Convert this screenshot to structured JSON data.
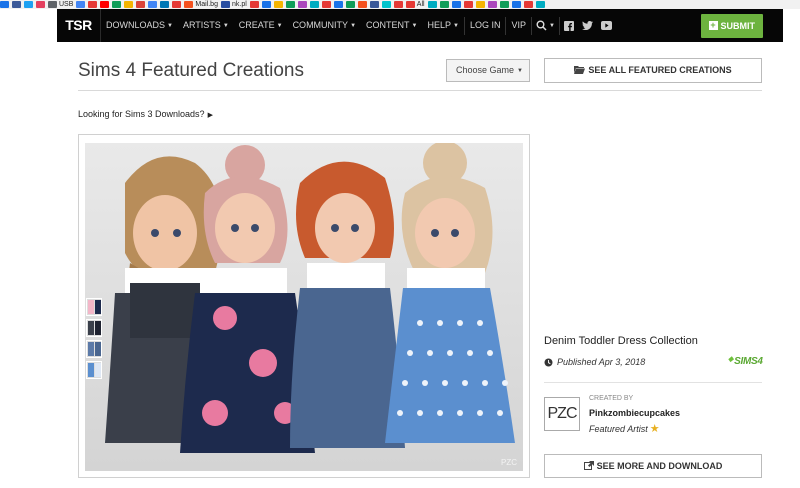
{
  "bookmarks": [
    {
      "label": "",
      "color": "#1a73e8"
    },
    {
      "label": "",
      "color": "#3b5998"
    },
    {
      "label": "",
      "color": "#1da1f2"
    },
    {
      "label": "",
      "color": "#e4405f"
    },
    {
      "label": "USB",
      "color": "#5f6368"
    },
    {
      "label": "",
      "color": "#4285f4"
    },
    {
      "label": "",
      "color": "#e53935"
    },
    {
      "label": "",
      "color": "#ff0000"
    },
    {
      "label": "",
      "color": "#0f9d58"
    },
    {
      "label": "",
      "color": "#f4b400"
    },
    {
      "label": "",
      "color": "#db4437"
    },
    {
      "label": "",
      "color": "#4285f4"
    },
    {
      "label": "",
      "color": "#0077b5"
    },
    {
      "label": "",
      "color": "#e53935"
    },
    {
      "label": "Mail.bg",
      "color": "#f4511e"
    },
    {
      "label": "nk.pl",
      "color": "#2a4fa1"
    },
    {
      "label": "",
      "color": "#e53935"
    },
    {
      "label": "",
      "color": "#1a73e8"
    },
    {
      "label": "",
      "color": "#f4b400"
    },
    {
      "label": "",
      "color": "#0f9d58"
    },
    {
      "label": "",
      "color": "#ab47bc"
    },
    {
      "label": "",
      "color": "#00acc1"
    },
    {
      "label": "",
      "color": "#e53935"
    },
    {
      "label": "",
      "color": "#1a73e8"
    },
    {
      "label": "",
      "color": "#0f9d58"
    },
    {
      "label": "",
      "color": "#f4511e"
    },
    {
      "label": "",
      "color": "#3b5998"
    },
    {
      "label": "",
      "color": "#00c4cc"
    },
    {
      "label": "",
      "color": "#e53935"
    },
    {
      "label": "All",
      "color": "#e53935"
    },
    {
      "label": "",
      "color": "#00acc1"
    },
    {
      "label": "",
      "color": "#0f9d58"
    },
    {
      "label": "",
      "color": "#1a73e8"
    },
    {
      "label": "",
      "color": "#e53935"
    },
    {
      "label": "",
      "color": "#f4b400"
    },
    {
      "label": "",
      "color": "#ab47bc"
    },
    {
      "label": "",
      "color": "#0f9d58"
    },
    {
      "label": "",
      "color": "#1a73e8"
    },
    {
      "label": "",
      "color": "#e53935"
    },
    {
      "label": "",
      "color": "#00acc1"
    }
  ],
  "nav": {
    "logo": "TSR",
    "items": [
      {
        "label": "Downloads",
        "caret": true
      },
      {
        "label": "Artists",
        "caret": true
      },
      {
        "label": "Create",
        "caret": true
      },
      {
        "label": "Community",
        "caret": true
      },
      {
        "label": "Content",
        "caret": true
      },
      {
        "label": "Help",
        "caret": true
      }
    ],
    "login": "Log In",
    "vip": "VIP",
    "submit": "Submit",
    "submit_color": "#6db33f"
  },
  "header": {
    "title": "Sims 4 Featured Creations",
    "choose_game": "Choose Game",
    "see_all": "See All Featured Creations",
    "sims3_link": "Looking for Sims 3 Downloads?"
  },
  "feature": {
    "title": "Denim Toddler Dress Collection",
    "published": "Published Apr 3, 2018",
    "game_badge": "SIMS4",
    "created_by_label": "Created By",
    "creator": "Pinkzombiecupcakes",
    "creator_role": "Featured Artist",
    "avatar_text": "PZC",
    "watermark": "PZC",
    "see_more": "See More and Download",
    "swatches": [
      {
        "a": "#f3b6c8",
        "b": "#1d2a4d"
      },
      {
        "a": "#3a3f4a",
        "b": "#1e2230"
      },
      {
        "a": "#5c7aa8",
        "b": "#4a6690"
      },
      {
        "a": "#5b8fcf",
        "b": "#dfe8f5"
      }
    ]
  }
}
